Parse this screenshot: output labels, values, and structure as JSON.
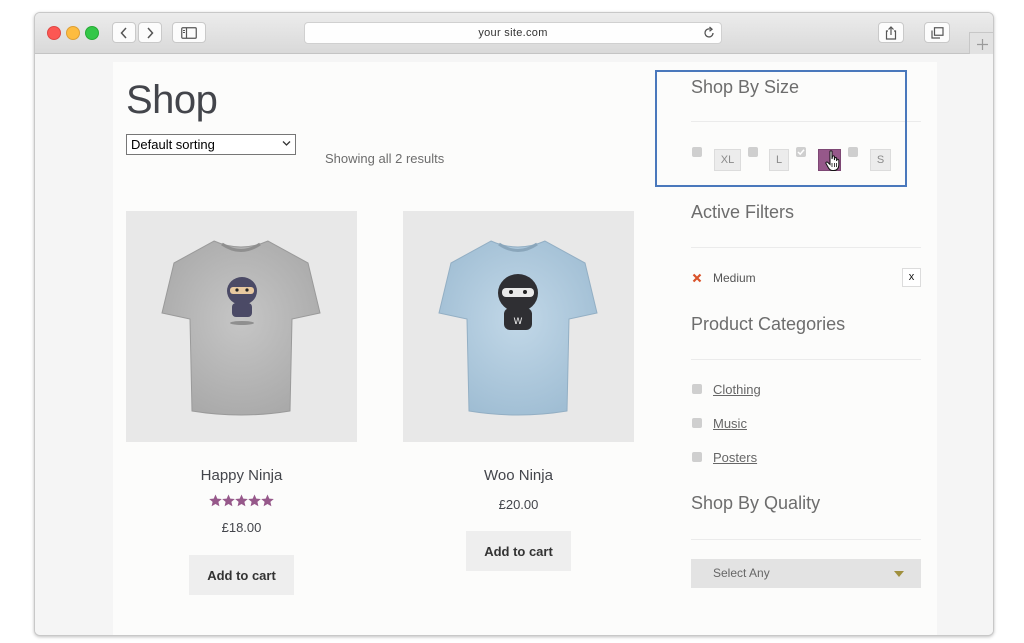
{
  "browser": {
    "url": "your site.com"
  },
  "shop": {
    "title": "Shop",
    "sorting": "Default sorting",
    "results_text": "Showing all 2 results",
    "products": [
      {
        "name": "Happy Ninja",
        "price": "£18.00",
        "rating": 5,
        "button": "Add to cart",
        "shirt_color": "#bdbdbd"
      },
      {
        "name": "Woo Ninja",
        "price": "£20.00",
        "button": "Add to cart",
        "shirt_color": "#b3cde0"
      }
    ]
  },
  "sidebar": {
    "size_widget": {
      "title": "Shop By Size",
      "sizes": [
        {
          "label": "XL",
          "checked": false
        },
        {
          "label": "L",
          "checked": false
        },
        {
          "label": "M",
          "checked": true
        },
        {
          "label": "S",
          "checked": false
        }
      ]
    },
    "active_filters": {
      "title": "Active Filters",
      "items": [
        {
          "label": "Medium",
          "remove": "x"
        }
      ]
    },
    "categories": {
      "title": "Product Categories",
      "items": [
        "Clothing",
        "Music",
        "Posters"
      ]
    },
    "quality": {
      "title": "Shop By Quality",
      "select_value": "Select Any"
    }
  },
  "colors": {
    "accent": "#96588a",
    "highlight_border": "#4a78bc",
    "remove_x": "#d9532b"
  }
}
